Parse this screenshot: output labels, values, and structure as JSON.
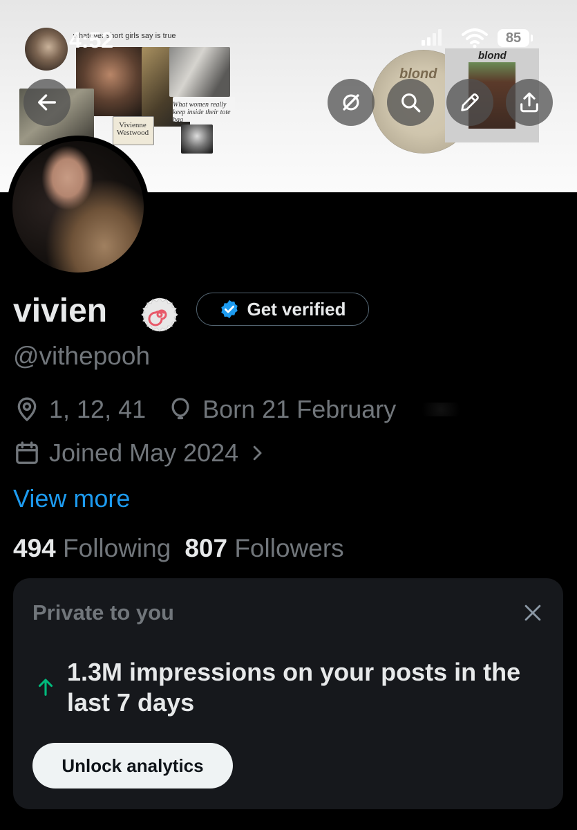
{
  "status_bar": {
    "time": "4:52",
    "battery": "85"
  },
  "banner": {
    "caption_top": "whatever short girls say is true",
    "caption_women": "What women really keep inside their tote bag",
    "caption_brand": "Vivienne Westwood",
    "album_text_1": "blond",
    "album_text_2": "blond"
  },
  "header_buttons": {
    "back_icon": "arrow-left-icon",
    "grok_icon": "grok-icon",
    "search_icon": "search-icon",
    "edit_icon": "pencil-icon",
    "share_icon": "share-icon"
  },
  "profile": {
    "display_name": "vivien",
    "handle": "@vithepooh",
    "get_verified_label": "Get verified",
    "location": "1, 12, 41",
    "birthday": "Born 21 February",
    "joined": "Joined May 2024",
    "view_more": "View more",
    "following_count": "494",
    "following_label": "Following",
    "followers_count": "807",
    "followers_label": "Followers"
  },
  "private_card": {
    "title": "Private to you",
    "impressions_text": "1.3M impressions on your posts in the last 7 days",
    "unlock_label": "Unlock analytics"
  },
  "colors": {
    "background": "#000000",
    "accent_blue": "#1d9bf0",
    "muted_text": "#71767b",
    "card_bg": "#16181c",
    "positive_green": "#00ba7c"
  }
}
